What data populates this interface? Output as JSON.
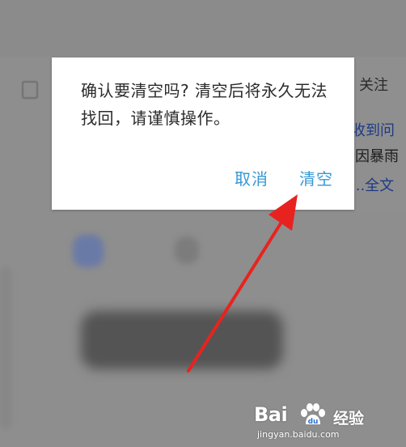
{
  "background": {
    "follow_label": "关注",
    "article_lines": [
      "收到问",
      "因暴雨",
      "...全文"
    ]
  },
  "dialog": {
    "message": "确认要清空吗? 清空后将永久无法找回，请谨慎操作。",
    "cancel_label": "取消",
    "confirm_label": "清空"
  },
  "watermark": {
    "brand": "Bai",
    "suffix": "经验",
    "url": "jingyan.baidu.com"
  },
  "colors": {
    "dim_overlay": "#8e8e8e",
    "dialog_bg": "#ffffff",
    "dialog_text": "#2b2b2b",
    "button_accent": "#3598d4",
    "annotation_arrow": "#e8231f"
  },
  "icons": [
    "annotation-arrow-icon",
    "baidu-paw-icon"
  ]
}
